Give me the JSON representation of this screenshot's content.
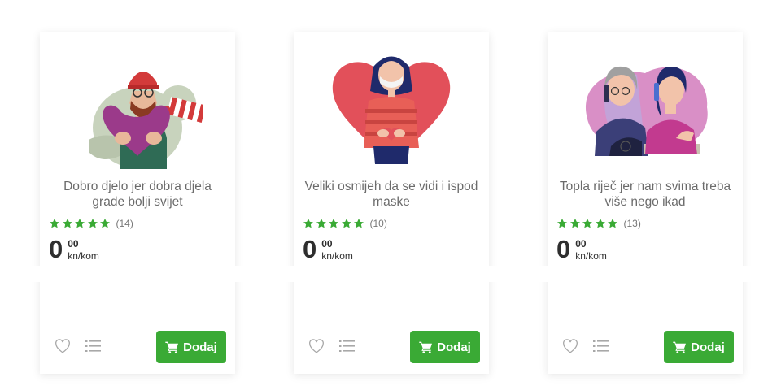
{
  "products": [
    {
      "title": "Dobro djelo jer dobra djela grade bolji svijet",
      "rating_count": "(14)",
      "stars": 5,
      "price_main": "0",
      "price_cents": "00",
      "price_unit": "kn/kom",
      "add_label": "Dodaj",
      "illustration": "man-with-heart-and-scarf"
    },
    {
      "title": "Veliki osmijeh da se vidi i ispod maske",
      "rating_count": "(10)",
      "stars": 5,
      "price_main": "0",
      "price_cents": "00",
      "price_unit": "kn/kom",
      "add_label": "Dodaj",
      "illustration": "woman-with-mask-heart"
    },
    {
      "title": "Topla riječ jer nam svima treba više nego ikad",
      "rating_count": "(13)",
      "stars": 5,
      "price_main": "0",
      "price_cents": "00",
      "price_unit": "kn/kom",
      "add_label": "Dodaj",
      "illustration": "women-talking-on-phones"
    }
  ],
  "colors": {
    "accent_green": "#3aaa35",
    "star_green": "#3aaa35",
    "title_gray": "#6b6b6b",
    "price_dark": "#2e2e2e"
  },
  "icons": [
    "star-icon",
    "heart-icon",
    "list-icon",
    "cart-icon"
  ]
}
